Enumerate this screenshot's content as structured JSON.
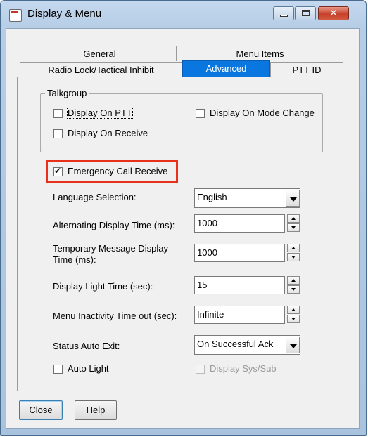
{
  "window": {
    "title": "Display & Menu",
    "close_glyph": "✕"
  },
  "tabs": {
    "general": "General",
    "menu_items": "Menu Items",
    "radio_lock": "Radio Lock/Tactical Inhibit",
    "advanced": "Advanced",
    "ptt_id": "PTT ID",
    "active": "Advanced"
  },
  "talkgroup": {
    "legend": "Talkgroup",
    "display_on_ptt": {
      "label": "Display On PTT",
      "checked": false
    },
    "display_on_mode_change": {
      "label": "Display On Mode Change",
      "checked": false
    },
    "display_on_receive": {
      "label": "Display On Receive",
      "checked": false
    }
  },
  "emergency_call_receive": {
    "label": "Emergency Call Receive",
    "checked": true
  },
  "settings": {
    "language_selection": {
      "label": "Language Selection:",
      "value": "English"
    },
    "alternating_display_time": {
      "label": "Alternating Display Time (ms):",
      "value": "1000"
    },
    "temporary_message_display_time": {
      "label_line1": "Temporary Message Display",
      "label_line2": "Time (ms):",
      "value": "1000"
    },
    "display_light_time": {
      "label": "Display Light Time (sec):",
      "value": "15"
    },
    "menu_inactivity_timeout": {
      "label": "Menu Inactivity Time out (sec):",
      "value": "Infinite"
    },
    "status_auto_exit": {
      "label": "Status Auto Exit:",
      "value": "On Successful Ack"
    }
  },
  "auto_light": {
    "label": "Auto Light",
    "checked": false
  },
  "display_sys_sub": {
    "label": "Display Sys/Sub",
    "checked": false,
    "enabled": false
  },
  "buttons": {
    "close": "Close",
    "help": "Help"
  },
  "colors": {
    "active_tab": "#0a77e0",
    "highlight": "#e8311a",
    "title_close": "#c7402a"
  }
}
